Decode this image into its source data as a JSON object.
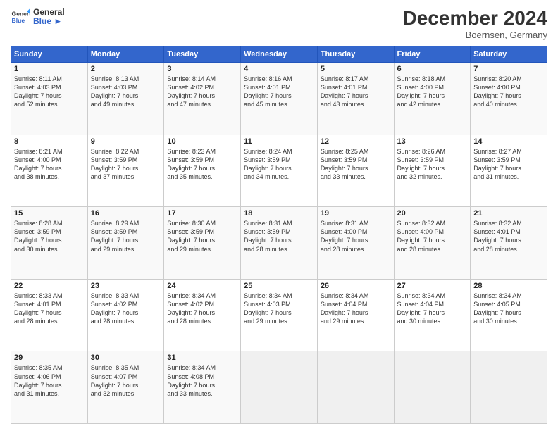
{
  "header": {
    "logo_line1": "General",
    "logo_line2": "Blue",
    "month": "December 2024",
    "location": "Boernsen, Germany"
  },
  "weekdays": [
    "Sunday",
    "Monday",
    "Tuesday",
    "Wednesday",
    "Thursday",
    "Friday",
    "Saturday"
  ],
  "weeks": [
    [
      {
        "day": "1",
        "lines": [
          "Sunrise: 8:11 AM",
          "Sunset: 4:03 PM",
          "Daylight: 7 hours",
          "and 52 minutes."
        ]
      },
      {
        "day": "2",
        "lines": [
          "Sunrise: 8:13 AM",
          "Sunset: 4:03 PM",
          "Daylight: 7 hours",
          "and 49 minutes."
        ]
      },
      {
        "day": "3",
        "lines": [
          "Sunrise: 8:14 AM",
          "Sunset: 4:02 PM",
          "Daylight: 7 hours",
          "and 47 minutes."
        ]
      },
      {
        "day": "4",
        "lines": [
          "Sunrise: 8:16 AM",
          "Sunset: 4:01 PM",
          "Daylight: 7 hours",
          "and 45 minutes."
        ]
      },
      {
        "day": "5",
        "lines": [
          "Sunrise: 8:17 AM",
          "Sunset: 4:01 PM",
          "Daylight: 7 hours",
          "and 43 minutes."
        ]
      },
      {
        "day": "6",
        "lines": [
          "Sunrise: 8:18 AM",
          "Sunset: 4:00 PM",
          "Daylight: 7 hours",
          "and 42 minutes."
        ]
      },
      {
        "day": "7",
        "lines": [
          "Sunrise: 8:20 AM",
          "Sunset: 4:00 PM",
          "Daylight: 7 hours",
          "and 40 minutes."
        ]
      }
    ],
    [
      {
        "day": "8",
        "lines": [
          "Sunrise: 8:21 AM",
          "Sunset: 4:00 PM",
          "Daylight: 7 hours",
          "and 38 minutes."
        ]
      },
      {
        "day": "9",
        "lines": [
          "Sunrise: 8:22 AM",
          "Sunset: 3:59 PM",
          "Daylight: 7 hours",
          "and 37 minutes."
        ]
      },
      {
        "day": "10",
        "lines": [
          "Sunrise: 8:23 AM",
          "Sunset: 3:59 PM",
          "Daylight: 7 hours",
          "and 35 minutes."
        ]
      },
      {
        "day": "11",
        "lines": [
          "Sunrise: 8:24 AM",
          "Sunset: 3:59 PM",
          "Daylight: 7 hours",
          "and 34 minutes."
        ]
      },
      {
        "day": "12",
        "lines": [
          "Sunrise: 8:25 AM",
          "Sunset: 3:59 PM",
          "Daylight: 7 hours",
          "and 33 minutes."
        ]
      },
      {
        "day": "13",
        "lines": [
          "Sunrise: 8:26 AM",
          "Sunset: 3:59 PM",
          "Daylight: 7 hours",
          "and 32 minutes."
        ]
      },
      {
        "day": "14",
        "lines": [
          "Sunrise: 8:27 AM",
          "Sunset: 3:59 PM",
          "Daylight: 7 hours",
          "and 31 minutes."
        ]
      }
    ],
    [
      {
        "day": "15",
        "lines": [
          "Sunrise: 8:28 AM",
          "Sunset: 3:59 PM",
          "Daylight: 7 hours",
          "and 30 minutes."
        ]
      },
      {
        "day": "16",
        "lines": [
          "Sunrise: 8:29 AM",
          "Sunset: 3:59 PM",
          "Daylight: 7 hours",
          "and 29 minutes."
        ]
      },
      {
        "day": "17",
        "lines": [
          "Sunrise: 8:30 AM",
          "Sunset: 3:59 PM",
          "Daylight: 7 hours",
          "and 29 minutes."
        ]
      },
      {
        "day": "18",
        "lines": [
          "Sunrise: 8:31 AM",
          "Sunset: 3:59 PM",
          "Daylight: 7 hours",
          "and 28 minutes."
        ]
      },
      {
        "day": "19",
        "lines": [
          "Sunrise: 8:31 AM",
          "Sunset: 4:00 PM",
          "Daylight: 7 hours",
          "and 28 minutes."
        ]
      },
      {
        "day": "20",
        "lines": [
          "Sunrise: 8:32 AM",
          "Sunset: 4:00 PM",
          "Daylight: 7 hours",
          "and 28 minutes."
        ]
      },
      {
        "day": "21",
        "lines": [
          "Sunrise: 8:32 AM",
          "Sunset: 4:01 PM",
          "Daylight: 7 hours",
          "and 28 minutes."
        ]
      }
    ],
    [
      {
        "day": "22",
        "lines": [
          "Sunrise: 8:33 AM",
          "Sunset: 4:01 PM",
          "Daylight: 7 hours",
          "and 28 minutes."
        ]
      },
      {
        "day": "23",
        "lines": [
          "Sunrise: 8:33 AM",
          "Sunset: 4:02 PM",
          "Daylight: 7 hours",
          "and 28 minutes."
        ]
      },
      {
        "day": "24",
        "lines": [
          "Sunrise: 8:34 AM",
          "Sunset: 4:02 PM",
          "Daylight: 7 hours",
          "and 28 minutes."
        ]
      },
      {
        "day": "25",
        "lines": [
          "Sunrise: 8:34 AM",
          "Sunset: 4:03 PM",
          "Daylight: 7 hours",
          "and 29 minutes."
        ]
      },
      {
        "day": "26",
        "lines": [
          "Sunrise: 8:34 AM",
          "Sunset: 4:04 PM",
          "Daylight: 7 hours",
          "and 29 minutes."
        ]
      },
      {
        "day": "27",
        "lines": [
          "Sunrise: 8:34 AM",
          "Sunset: 4:04 PM",
          "Daylight: 7 hours",
          "and 30 minutes."
        ]
      },
      {
        "day": "28",
        "lines": [
          "Sunrise: 8:34 AM",
          "Sunset: 4:05 PM",
          "Daylight: 7 hours",
          "and 30 minutes."
        ]
      }
    ],
    [
      {
        "day": "29",
        "lines": [
          "Sunrise: 8:35 AM",
          "Sunset: 4:06 PM",
          "Daylight: 7 hours",
          "and 31 minutes."
        ]
      },
      {
        "day": "30",
        "lines": [
          "Sunrise: 8:35 AM",
          "Sunset: 4:07 PM",
          "Daylight: 7 hours",
          "and 32 minutes."
        ]
      },
      {
        "day": "31",
        "lines": [
          "Sunrise: 8:34 AM",
          "Sunset: 4:08 PM",
          "Daylight: 7 hours",
          "and 33 minutes."
        ]
      },
      null,
      null,
      null,
      null
    ]
  ]
}
